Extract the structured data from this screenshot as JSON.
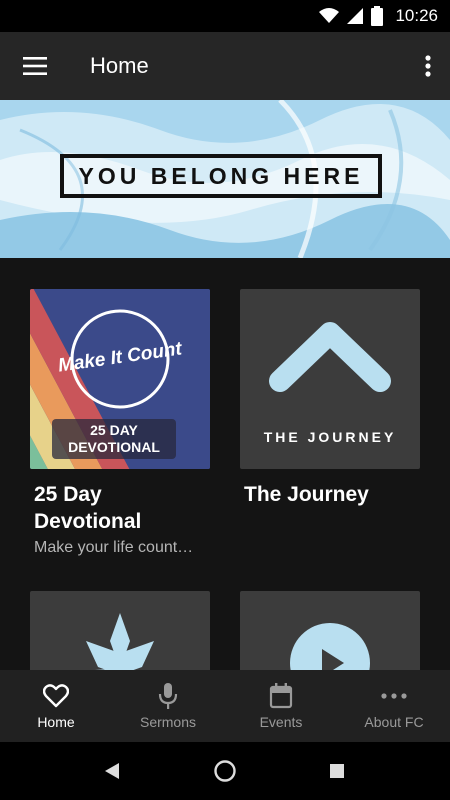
{
  "status_bar": {
    "time": "10:26"
  },
  "app_bar": {
    "title": "Home"
  },
  "banner": {
    "text": "YOU BELONG HERE"
  },
  "cards": [
    {
      "title": "25 Day Devotional",
      "subtitle": "Make your life count…",
      "image_script_text": "Make It Count",
      "image_label": "25 DAY DEVOTIONAL"
    },
    {
      "title": "The Journey",
      "image_label": "THE JOURNEY"
    }
  ],
  "bottom_nav": [
    {
      "label": "Home",
      "icon": "heart-icon",
      "active": true
    },
    {
      "label": "Sermons",
      "icon": "microphone-icon"
    },
    {
      "label": "Events",
      "icon": "calendar-icon"
    },
    {
      "label": "About FC",
      "icon": "more-horizontal-icon"
    }
  ],
  "colors": {
    "background": "#141414",
    "app_bar": "#262626",
    "bottom_nav": "#212121",
    "accent_blue": "#b9dff0"
  }
}
